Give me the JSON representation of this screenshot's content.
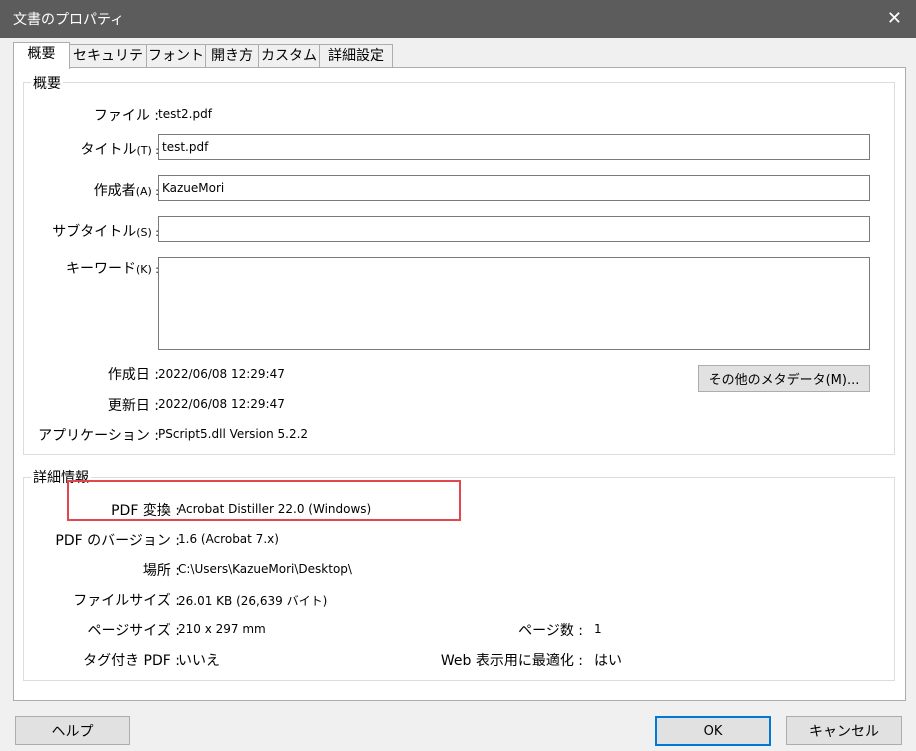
{
  "window": {
    "title": "文書のプロパティ",
    "close_glyph": "✕"
  },
  "tabs": [
    {
      "label": "概要",
      "active": true
    },
    {
      "label": "セキュリティ",
      "active": false
    },
    {
      "label": "フォント",
      "active": false
    },
    {
      "label": "開き方",
      "active": false
    },
    {
      "label": "カスタム",
      "active": false
    },
    {
      "label": "詳細設定",
      "active": false
    }
  ],
  "summary": {
    "legend": "概要",
    "file_label": "ファイル :",
    "file_value": "test2.pdf",
    "title_label": "タイトル",
    "title_key": "(T) :",
    "title_value": "test.pdf",
    "author_label": "作成者",
    "author_key": "(A) :",
    "author_value": "KazueMori",
    "subject_label": "サブタイトル",
    "subject_key": "(S) :",
    "subject_value": "",
    "keywords_label": "キーワード",
    "keywords_key": "(K) :",
    "keywords_value": "",
    "created_label": "作成日 :",
    "created_value": "2022/06/08 12:29:47",
    "modified_label": "更新日 :",
    "modified_value": "2022/06/08 12:29:47",
    "application_label": "アプリケーション :",
    "application_value": "PScript5.dll Version 5.2.2",
    "metadata_button": "その他のメタデータ(M)..."
  },
  "advanced": {
    "legend": "詳細情報",
    "producer_label": "PDF 変換 :",
    "producer_value": "Acrobat Distiller 22.0 (Windows)",
    "version_label": "PDF のバージョン :",
    "version_value": "1.6 (Acrobat 7.x)",
    "location_label": "場所 :",
    "location_value": "C:\\Users\\KazueMori\\Desktop\\",
    "filesize_label": "ファイルサイズ :",
    "filesize_value": "26.01 KB (26,639 バイト)",
    "pagesize_label": "ページサイズ :",
    "pagesize_value": "210 x 297 mm",
    "pages_label": "ページ数 :",
    "pages_value": "1",
    "tagged_label": "タグ付き PDF :",
    "tagged_value": "いいえ",
    "fastweb_label": "Web 表示用に最適化 :",
    "fastweb_value": "はい"
  },
  "buttons": {
    "help": "ヘルプ",
    "ok": "OK",
    "cancel": "キャンセル"
  },
  "colors": {
    "titlebar": "#5c5c5c",
    "highlight": "#e0484d",
    "ok_border": "#0078d7"
  }
}
